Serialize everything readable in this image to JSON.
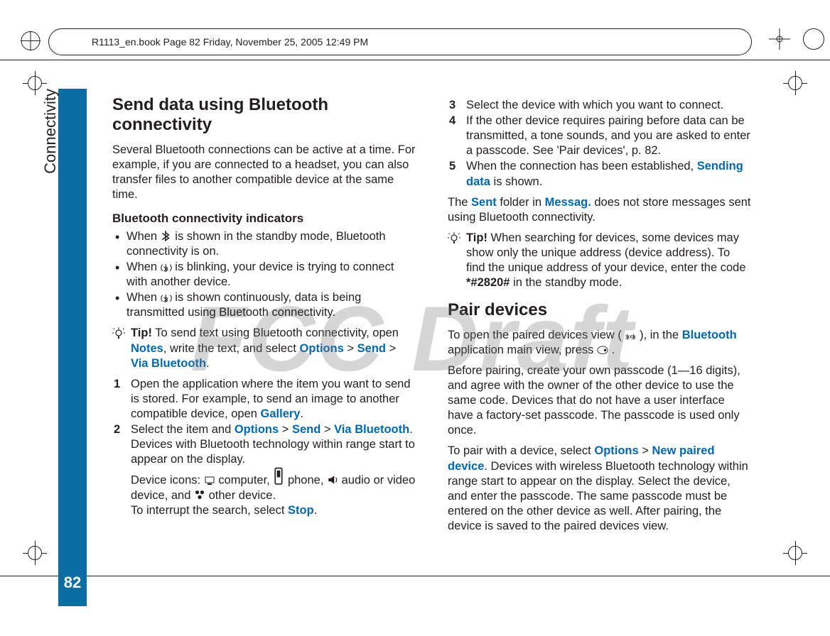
{
  "header": {
    "crop_text": "R1113_en.book  Page 82  Friday, November 25, 2005  12:49 PM"
  },
  "side": {
    "label": "Connectivity",
    "page_number": "82"
  },
  "watermark": "FCC Draft",
  "left": {
    "h2": "Send data using Bluetooth connectivity",
    "intro": "Several Bluetooth connections can be active at a time. For example, if you are connected to a headset, you can also transfer files to another compatible device at the same time.",
    "sub": "Bluetooth connectivity indicators",
    "bul1_a": "When ",
    "bul1_b": " is shown in the standby mode, Bluetooth connectivity is on.",
    "bul2_a": "When ",
    "bul2_b": " is blinking, your device is trying to connect with another device.",
    "bul3_a": "When ",
    "bul3_b": " is shown continuously, data is being transmitted using Bluetooth connectivity.",
    "tip_label": "Tip!",
    "tip1_a": " To send text using Bluetooth connectivity, open ",
    "tip1_notes": "Notes",
    "tip1_b": ", write the text, and select ",
    "tip1_options": "Options",
    "tip1_gt1": " > ",
    "tip1_send": "Send",
    "tip1_gt2": " > ",
    "tip1_via": "Via Bluetooth",
    "tip1_end": ".",
    "n1_a": "Open the application where the item you want to send is stored. For example, to send an image to another compatible device, open ",
    "n1_gallery": "Gallery",
    "n1_end": ".",
    "n2_a": "Select the item and ",
    "n2_options": "Options",
    "n2_gt1": " > ",
    "n2_send": "Send",
    "n2_gt2": " > ",
    "n2_via": "Via Bluetooth",
    "n2_b": ". Devices with Bluetooth technology within range start to appear on the display.",
    "n2_icons_a": "Device icons: ",
    "n2_comp": " computer, ",
    "n2_phone": " phone, ",
    "n2_av": " audio or video device, and ",
    "n2_other": " other device.",
    "n2_c": "To interrupt the search, select ",
    "n2_stop": "Stop",
    "n2_end": "."
  },
  "right": {
    "n3": "Select the device with which you want to connect.",
    "n4": "If the other device requires pairing before data can be transmitted, a tone sounds, and you are asked to enter a passcode. See 'Pair devices', p. 82.",
    "n5_a": "When the connection has been established, ",
    "n5_sending": "Sending data",
    "n5_b": " is shown.",
    "sent_a": "The ",
    "sent_sent": "Sent",
    "sent_b": " folder in ",
    "sent_messag": "Messag.",
    "sent_c": " does not store messages sent using Bluetooth connectivity.",
    "tip_label": "Tip!",
    "tip2_a": " When searching for devices, some devices may show only the unique address (device address). To find the unique address of your device, enter the code ",
    "tip2_code": "*#2820#",
    "tip2_b": " in the standby mode.",
    "h2": "Pair devices",
    "pair_a": "To open the paired devices view (",
    "pair_b": "), in the ",
    "pair_bt": "Bluetooth",
    "pair_c": " application main view, press ",
    "pair_end": ".",
    "passcode": "Before pairing, create your own passcode (1—16 digits), and agree with the owner of the other device to use the same code. Devices that do not have a user interface have a factory-set passcode. The passcode is used only once.",
    "topair_a": "To pair with a device, select ",
    "topair_options": "Options",
    "topair_gt": " > ",
    "topair_new": "New paired device",
    "topair_b": ". Devices with wireless Bluetooth technology within range start to appear on the display. Select the device, and enter the passcode. The same passcode must be entered on the other device as well. After pairing, the device is saved to the paired devices view."
  }
}
